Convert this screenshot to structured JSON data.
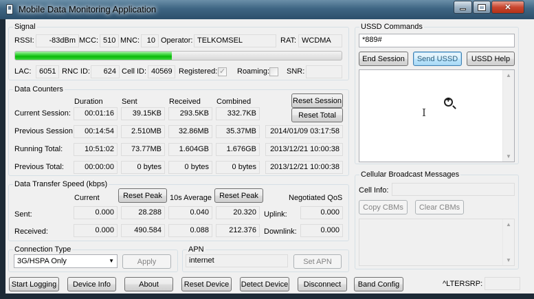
{
  "window": {
    "title": "Mobile Data Monitoring Application"
  },
  "signal": {
    "group_title": "Signal",
    "rssi_label": "RSSI:",
    "rssi": "-83dBm",
    "mcc_label": "MCC:",
    "mcc": "510",
    "mnc_label": "MNC:",
    "mnc": "10",
    "operator_label": "Operator:",
    "operator": "TELKOMSEL",
    "rat_label": "RAT:",
    "rat": "WCDMA",
    "strength_fraction": 0.48,
    "lac_label": "LAC:",
    "lac": "6051",
    "rnc_label": "RNC ID:",
    "rnc": "624",
    "cell_label": "Cell ID:",
    "cell": "40569",
    "registered_label": "Registered:",
    "registered_mark": "✓",
    "roaming_label": "Roaming:",
    "snr_label": "SNR:",
    "snr": ""
  },
  "counters": {
    "group_title": "Data Counters",
    "headers": [
      "Duration",
      "Sent",
      "Received",
      "Combined"
    ],
    "reset_session": "Reset Session",
    "reset_total": "Reset Total",
    "rows": [
      {
        "label": "Current Session:",
        "duration": "00:01:16",
        "sent": "39.15KB",
        "received": "293.5KB",
        "combined": "332.7KB",
        "date": ""
      },
      {
        "label": "Previous Session:",
        "duration": "00:14:54",
        "sent": "2.510MB",
        "received": "32.86MB",
        "combined": "35.37MB",
        "date": "2014/01/09 03:17:58"
      },
      {
        "label": "Running Total:",
        "duration": "10:51:02",
        "sent": "73.77MB",
        "received": "1.604GB",
        "combined": "1.676GB",
        "date": "2013/12/21 10:00:38"
      },
      {
        "label": "Previous Total:",
        "duration": "00:00:00",
        "sent": "0 bytes",
        "received": "0 bytes",
        "combined": "0 bytes",
        "date": "2013/12/21 10:00:38"
      }
    ]
  },
  "speed": {
    "group_title": "Data Transfer Speed (kbps)",
    "current_label": "Current",
    "reset_peak": "Reset Peak",
    "avg_label": "10s Average",
    "qos_label": "Negotiated QoS",
    "sent_label": "Sent:",
    "received_label": "Received:",
    "uplink_label": "Uplink:",
    "downlink_label": "Downlink:",
    "sent_current": "0.000",
    "sent_peak": "28.288",
    "sent_avg": "0.040",
    "sent_avg_peak": "20.320",
    "uplink": "0.000",
    "recv_current": "0.000",
    "recv_peak": "490.584",
    "recv_avg": "0.088",
    "recv_avg_peak": "212.376",
    "downlink": "0.000"
  },
  "connection": {
    "group_title": "Connection Type",
    "selected": "3G/HSPA Only",
    "apply": "Apply"
  },
  "apn": {
    "group_title": "APN",
    "value": "internet",
    "set_apn": "Set APN"
  },
  "ussd": {
    "group_title": "USSD Commands",
    "input": "*889#",
    "end_session": "End Session",
    "send_ussd": "Send USSD",
    "help": "USSD Help"
  },
  "cbm": {
    "group_title": "Cellular Broadcast Messages",
    "cell_info_label": "Cell Info:",
    "copy": "Copy CBMs",
    "clear": "Clear CBMs"
  },
  "bottom": {
    "start_logging": "Start Logging",
    "device_info": "Device Info",
    "about": "About",
    "reset_device": "Reset Device",
    "detect_device": "Detect Device",
    "disconnect": "Disconnect",
    "band_config": "Band Config",
    "lterssrp_label": "^LTERSRP:",
    "lterssrp": ""
  }
}
